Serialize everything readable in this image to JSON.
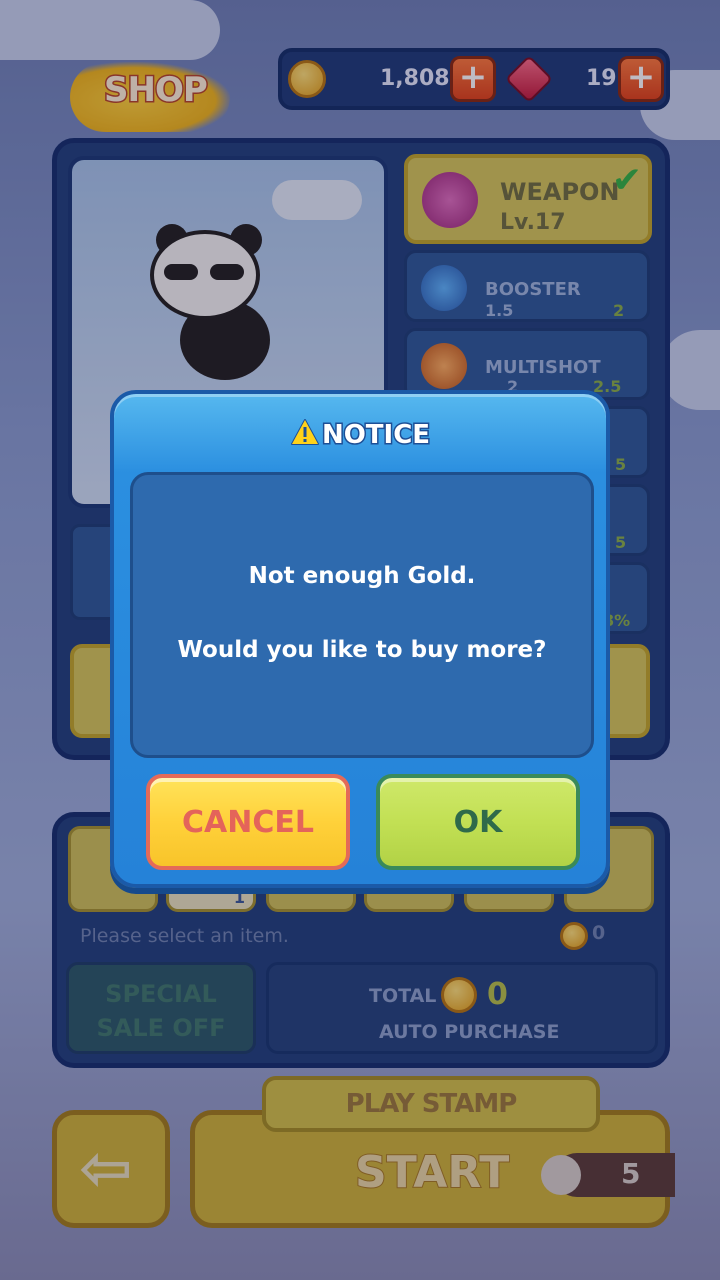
{
  "header": {
    "shop_title": "SHOP",
    "gold_amount": "1,808",
    "gem_amount": "19",
    "add_symbol": "+"
  },
  "upgrades": {
    "weapon_label": "WEAPON",
    "weapon_level": "Lv.17",
    "booster_label": "BOOSTER",
    "booster_stats_left": "1.5",
    "booster_stats_right": "2",
    "multishot_label": "MULTISHOT",
    "multishot_stats_left": "2",
    "multishot_stats_right": "2.5",
    "row3_stat": "5",
    "row4_stat": "5",
    "row5_stat": "8%"
  },
  "items_panel": {
    "hint": "Please select an item.",
    "selected_cost": "0",
    "slot2_count": "1"
  },
  "purchase": {
    "special_line1": "SPECIAL",
    "special_line2": "SALE OFF",
    "total_label": "TOTAL",
    "total_value": "0",
    "auto_purchase": "AUTO PURCHASE"
  },
  "footer": {
    "play_stamp": "PLAY STAMP",
    "start": "START",
    "stamp_count": "5"
  },
  "dialog": {
    "title": "NOTICE",
    "message_line1": "Not enough Gold.",
    "message_line2": "Would you like to buy more?",
    "cancel_label": "CANCEL",
    "ok_label": "OK"
  },
  "colors": {
    "dialog_blue": "#2582d8",
    "cancel_yellow": "#ffd13a",
    "ok_green": "#c2e054"
  }
}
